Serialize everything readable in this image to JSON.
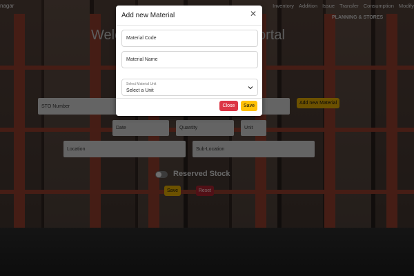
{
  "nav": {
    "brand": "nagar",
    "links": [
      "Inventory",
      "Addition",
      "Issue",
      "Transfer",
      "Consumption",
      "Modify"
    ],
    "section": "PLANNING & STORES"
  },
  "welcome": {
    "left": "Welc",
    "right": "ortal"
  },
  "form": {
    "sto_number": "STO Number",
    "add_material_label": "Add new Material",
    "date": "Date",
    "quantity": "Quantity",
    "unit": "Unit",
    "location": "Location",
    "sub_location": "Sub-Location",
    "reserved_stock": "Reserved Stock",
    "reserved_on": false,
    "save_label": "Save",
    "reset_label": "Reset"
  },
  "modal": {
    "title": "Add new Material",
    "close_icon": "close-icon",
    "material_code_placeholder": "Material Code",
    "material_name_placeholder": "Material Name",
    "unit_select_label": "Select Material Unit",
    "unit_select_value": "Select a Unit",
    "close_label": "Close",
    "save_label": "Save"
  },
  "colors": {
    "accent_yellow": "#ffc107",
    "danger_red": "#dc3545"
  }
}
